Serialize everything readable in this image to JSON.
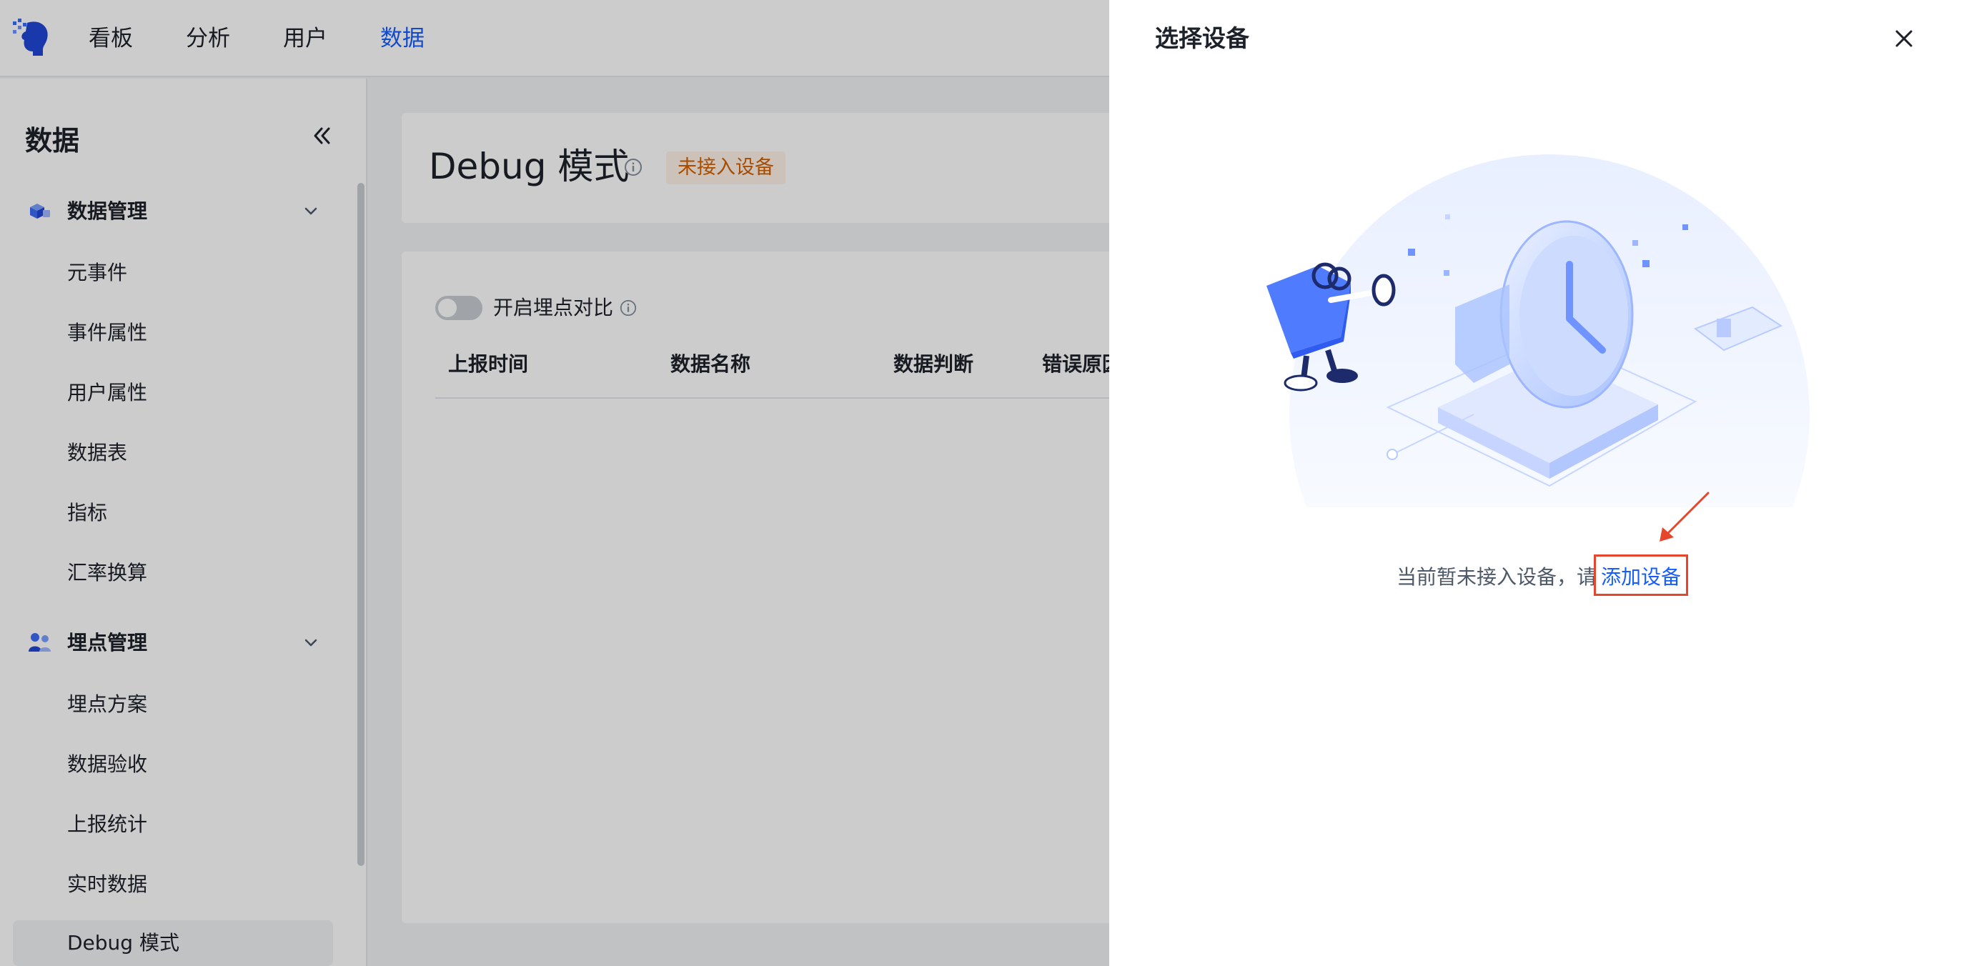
{
  "topnav": {
    "items": [
      {
        "label": "看板",
        "active": false
      },
      {
        "label": "分析",
        "active": false
      },
      {
        "label": "用户",
        "active": false
      },
      {
        "label": "数据",
        "active": true
      }
    ]
  },
  "sidebar": {
    "title": "数据",
    "groups": [
      {
        "label": "数据管理",
        "icon": "cube-stack-icon",
        "items": [
          "元事件",
          "事件属性",
          "用户属性",
          "数据表",
          "指标",
          "汇率换算"
        ]
      },
      {
        "label": "埋点管理",
        "icon": "people-icon",
        "items": [
          "埋点方案",
          "数据验收",
          "上报统计",
          "实时数据",
          "Debug 模式"
        ]
      }
    ],
    "active_item": "Debug 模式"
  },
  "main": {
    "title": "Debug 模式",
    "status_tag": "未接入设备",
    "toggle_label": "开启埋点对比",
    "toggle_on": false,
    "table_headers": [
      "上报时间",
      "数据名称",
      "数据判断",
      "错误原因"
    ]
  },
  "drawer": {
    "title": "选择设备",
    "empty_text": "当前暂未接入设备，请",
    "add_link": "添加设备"
  },
  "colors": {
    "accent": "#165dff",
    "tag_bg": "#fff3e8",
    "tag_text": "#d25f00",
    "annotation": "#e5472c"
  }
}
